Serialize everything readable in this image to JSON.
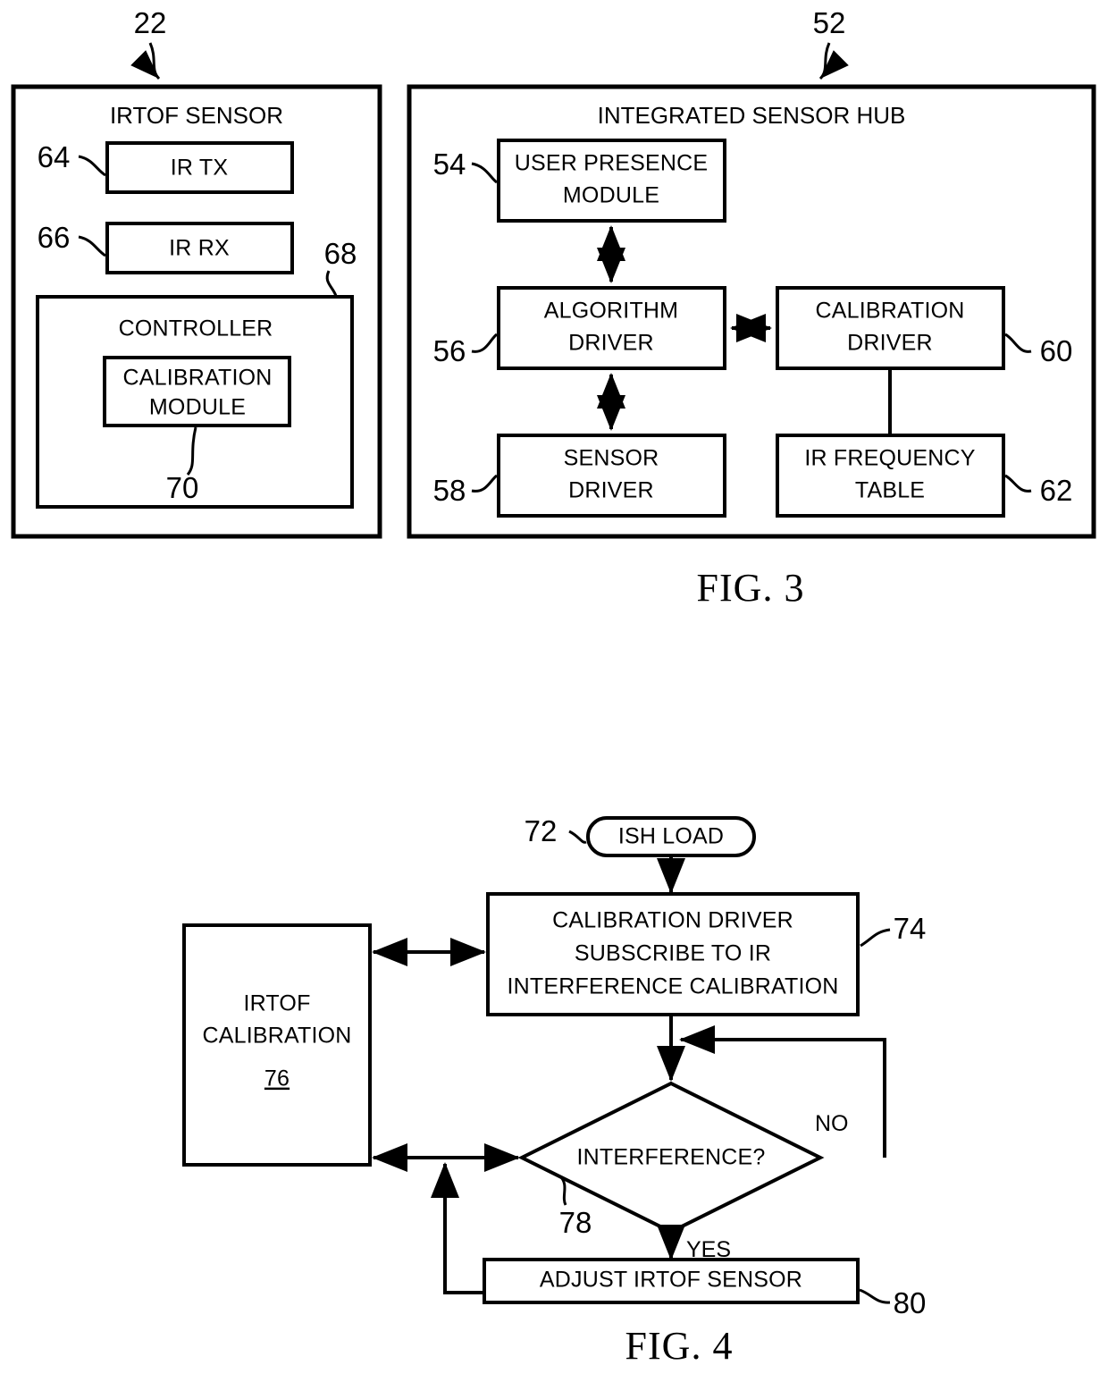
{
  "figures": [
    {
      "caption": "FIG. 3",
      "panels": [
        {
          "ref": "22",
          "title": "IRTOF SENSOR",
          "blocks": [
            {
              "ref": "64",
              "label": "IR TX"
            },
            {
              "ref": "66",
              "label": "IR RX"
            },
            {
              "ref": "68",
              "label": "CONTROLLER"
            },
            {
              "ref": "70",
              "label_line1": "CALIBRATION",
              "label_line2": "MODULE"
            }
          ]
        },
        {
          "ref": "52",
          "title": "INTEGRATED SENSOR HUB",
          "blocks": [
            {
              "ref": "54",
              "label_line1": "USER PRESENCE",
              "label_line2": "MODULE"
            },
            {
              "ref": "56",
              "label_line1": "ALGORITHM",
              "label_line2": "DRIVER"
            },
            {
              "ref": "58",
              "label_line1": "SENSOR",
              "label_line2": "DRIVER"
            },
            {
              "ref": "60",
              "label_line1": "CALIBRATION",
              "label_line2": "DRIVER"
            },
            {
              "ref": "62",
              "label_line1": "IR FREQUENCY",
              "label_line2": "TABLE"
            }
          ]
        }
      ]
    },
    {
      "caption": "FIG. 4",
      "nodes": [
        {
          "ref": "72",
          "label": "ISH LOAD",
          "shape": "terminator"
        },
        {
          "ref": "74",
          "shape": "process",
          "label_line1": "CALIBRATION DRIVER",
          "label_line2": "SUBSCRIBE TO IR",
          "label_line3": "INTERFERENCE CALIBRATION"
        },
        {
          "ref": "76",
          "shape": "process",
          "label_line1": "IRTOF",
          "label_line2": "CALIBRATION",
          "label_num": "76"
        },
        {
          "ref": "78",
          "shape": "decision",
          "label": "INTERFERENCE?"
        },
        {
          "ref": "80",
          "shape": "process",
          "label": "ADJUST IRTOF SENSOR"
        }
      ],
      "edge_labels": {
        "no": "NO",
        "yes": "YES"
      }
    }
  ]
}
